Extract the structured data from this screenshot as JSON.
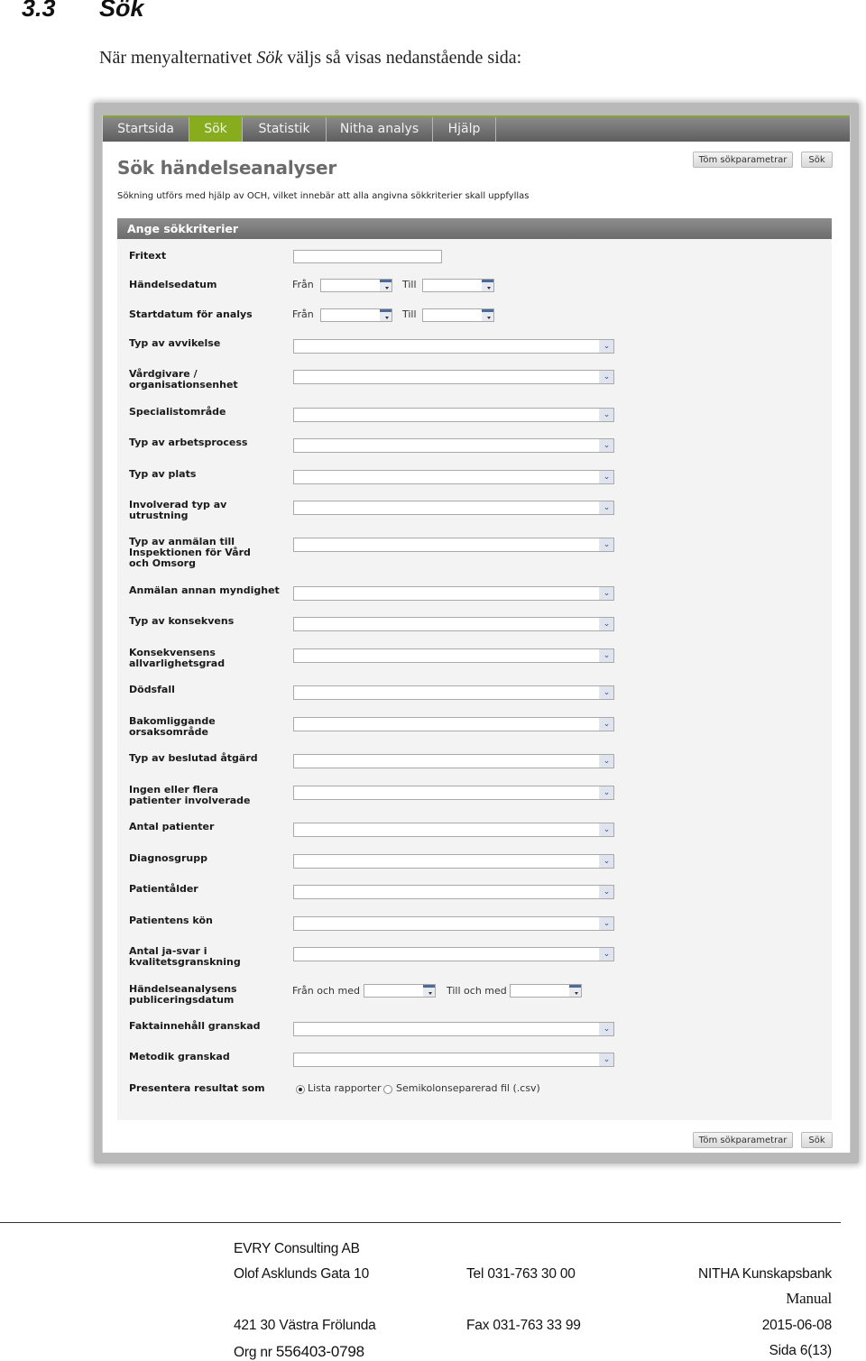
{
  "doc": {
    "section_number": "3.3",
    "section_title": "Sök",
    "intro_before": "När menyalternativet ",
    "intro_emphasis": "Sök",
    "intro_after": " väljs så visas nedanstående sida:"
  },
  "app": {
    "nav": [
      {
        "label": "Startsida",
        "active": false
      },
      {
        "label": "Sök",
        "active": true
      },
      {
        "label": "Statistik",
        "active": false
      },
      {
        "label": "Nitha analys",
        "active": false
      },
      {
        "label": "Hjälp",
        "active": false
      }
    ],
    "accent_color": "#87ac1e",
    "page_title": "Sök händelseanalyser",
    "page_subtitle": "Sökning utförs med hjälp av OCH, vilket innebär att alla angivna sökkriterier skall uppfyllas",
    "buttons": {
      "clear": "Töm sökparametrar",
      "search": "Sök"
    },
    "panel_title": "Ange sökkriterier",
    "fields": {
      "fritext": {
        "label": "Fritext",
        "value": ""
      },
      "handelsedatum": {
        "label": "Händelsedatum",
        "from_label": "Från",
        "to_label": "Till",
        "from_value": "",
        "to_value": ""
      },
      "startdatum": {
        "label": "Startdatum för analys",
        "from_label": "Från",
        "to_label": "Till",
        "from_value": "",
        "to_value": ""
      },
      "selects": [
        {
          "label": "Typ av avvikelse",
          "value": ""
        },
        {
          "label": "Vårdgivare / organisationsenhet",
          "value": ""
        },
        {
          "label": "Specialistområde",
          "value": ""
        },
        {
          "label": "Typ av arbetsprocess",
          "value": ""
        },
        {
          "label": "Typ av plats",
          "value": ""
        },
        {
          "label": "Involverad typ av utrustning",
          "value": ""
        },
        {
          "label": "Typ av anmälan till Inspektionen för Vård och Omsorg",
          "value": ""
        },
        {
          "label": "Anmälan annan myndighet",
          "value": ""
        },
        {
          "label": "Typ av konsekvens",
          "value": ""
        },
        {
          "label": "Konsekvensens allvarlighetsgrad",
          "value": ""
        },
        {
          "label": "Dödsfall",
          "value": ""
        },
        {
          "label": "Bakomliggande orsaksområde",
          "value": ""
        },
        {
          "label": "Typ av beslutad åtgärd",
          "value": ""
        },
        {
          "label": "Ingen eller flera patienter involverade",
          "value": ""
        },
        {
          "label": "Antal patienter",
          "value": ""
        },
        {
          "label": "Diagnosgrupp",
          "value": ""
        },
        {
          "label": "Patientålder",
          "value": ""
        },
        {
          "label": "Patientens kön",
          "value": ""
        },
        {
          "label": "Antal ja-svar i kvalitetsgranskning",
          "value": ""
        }
      ],
      "publiceringsdatum": {
        "label": "Händelseanalysens publiceringsdatum",
        "from_label": "Från och med",
        "to_label": "Till och med",
        "from_value": "",
        "to_value": ""
      },
      "selects_after": [
        {
          "label": "Faktainnehåll granskad",
          "value": ""
        },
        {
          "label": "Metodik granskad",
          "value": ""
        }
      ],
      "result_format": {
        "label": "Presentera resultat som",
        "options": [
          {
            "label": "Lista rapporter",
            "checked": true
          },
          {
            "label": "Semikolonseparerad fil (.csv)",
            "checked": false
          }
        ]
      }
    }
  },
  "footer": {
    "company": "EVRY Consulting AB",
    "street": "Olof Asklunds Gata 10",
    "city": "421 30  Västra Frölunda",
    "org_prefix": "Org nr ",
    "org_number": "556403-0798",
    "tel": "Tel 031-763 30 00",
    "fax": "Fax 031-763 33 99",
    "product": "NITHA Kunskapsbank",
    "doc_type": "Manual",
    "date": "2015-06-08",
    "page": "Sida 6(13)"
  }
}
